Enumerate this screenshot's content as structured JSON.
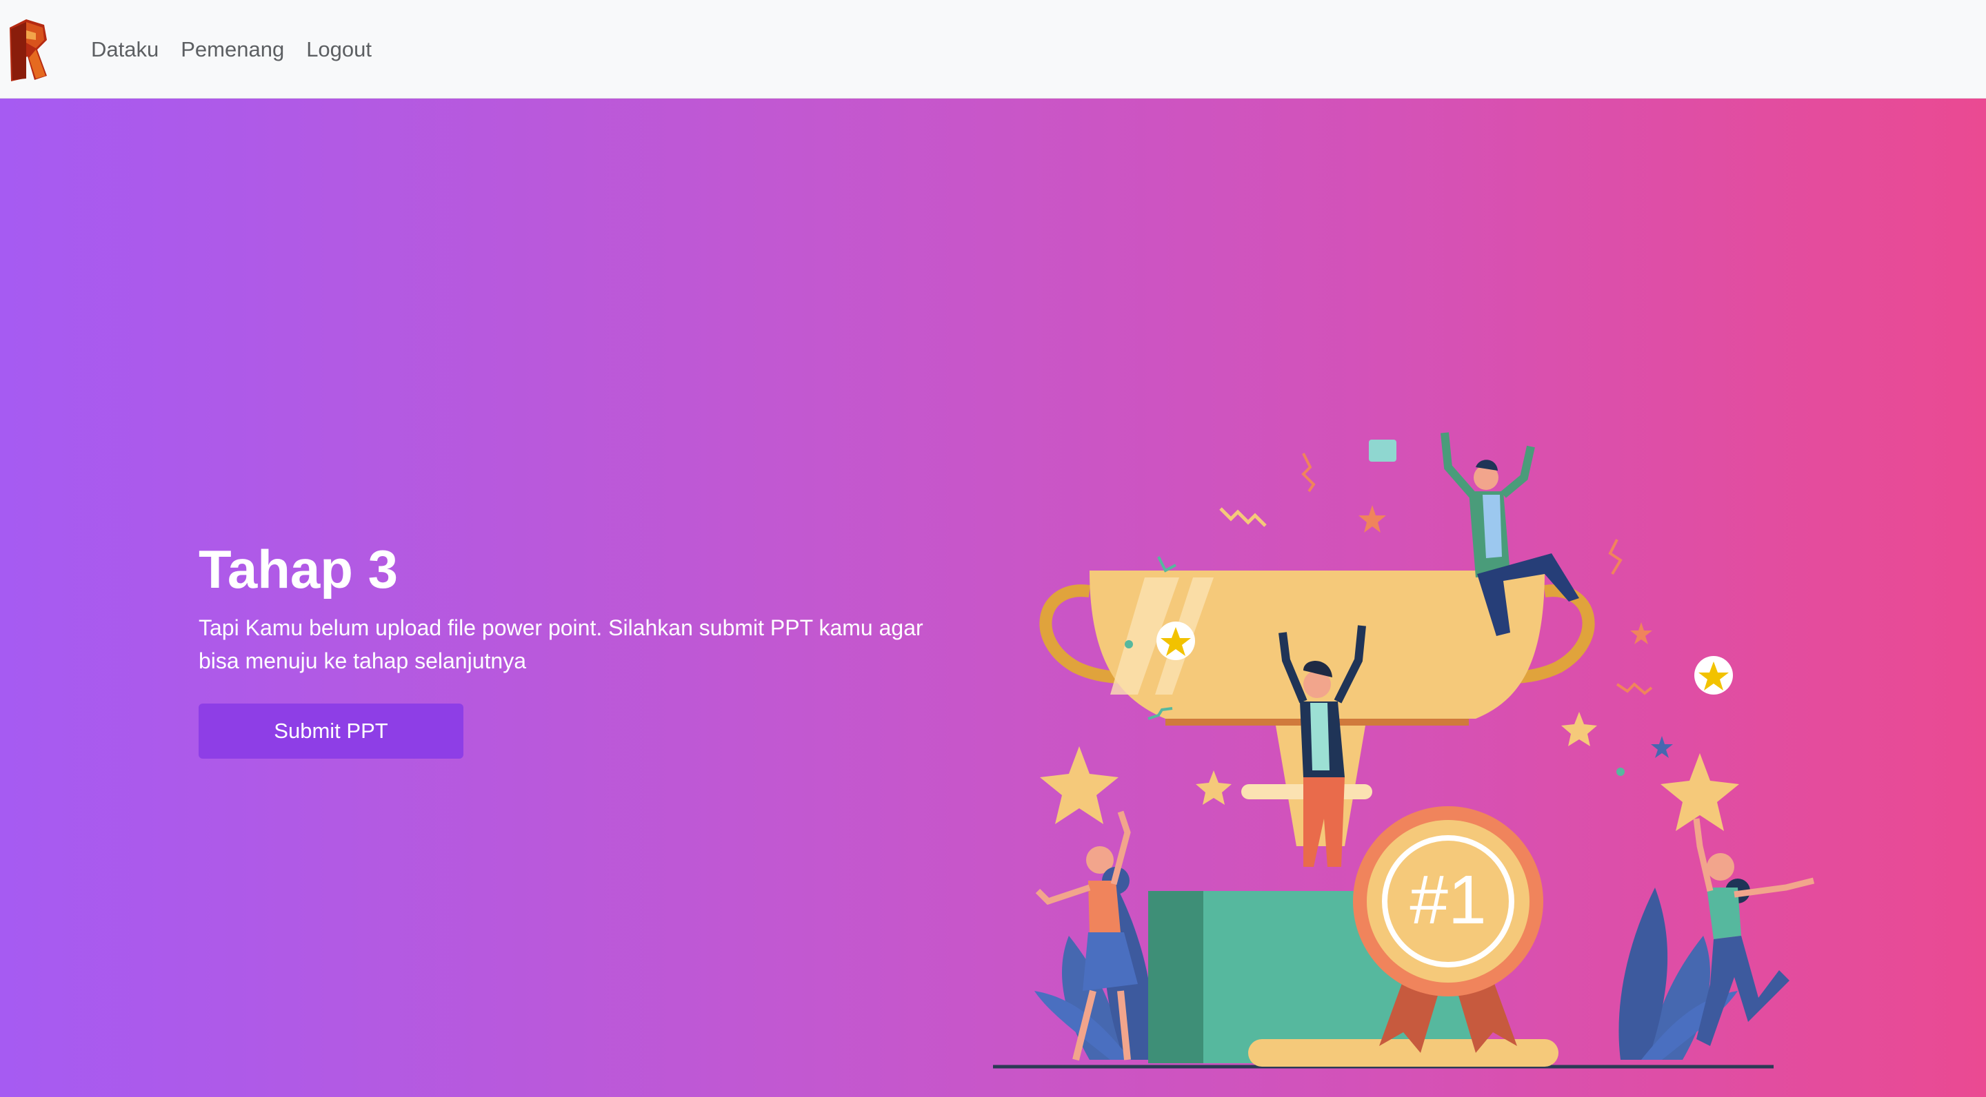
{
  "navbar": {
    "logo_icon": "r-logo-icon",
    "links": [
      {
        "label": "Dataku"
      },
      {
        "label": "Pemenang"
      },
      {
        "label": "Logout"
      }
    ]
  },
  "hero": {
    "title": "Tahap 3",
    "description": "Tapi Kamu belum upload file power point. Silahkan submit PPT kamu agar bisa menuju ke tahap selanjutnya",
    "button_label": "Submit PPT",
    "illustration": {
      "icon": "trophy-celebration-illustration",
      "medal_text": "#1"
    }
  },
  "colors": {
    "gradient_start": "#a65bf2",
    "gradient_end": "#ea4a92",
    "button": "#8e3ee6",
    "navbar_bg": "#f8f9fa",
    "nav_text": "#5c5f62"
  }
}
